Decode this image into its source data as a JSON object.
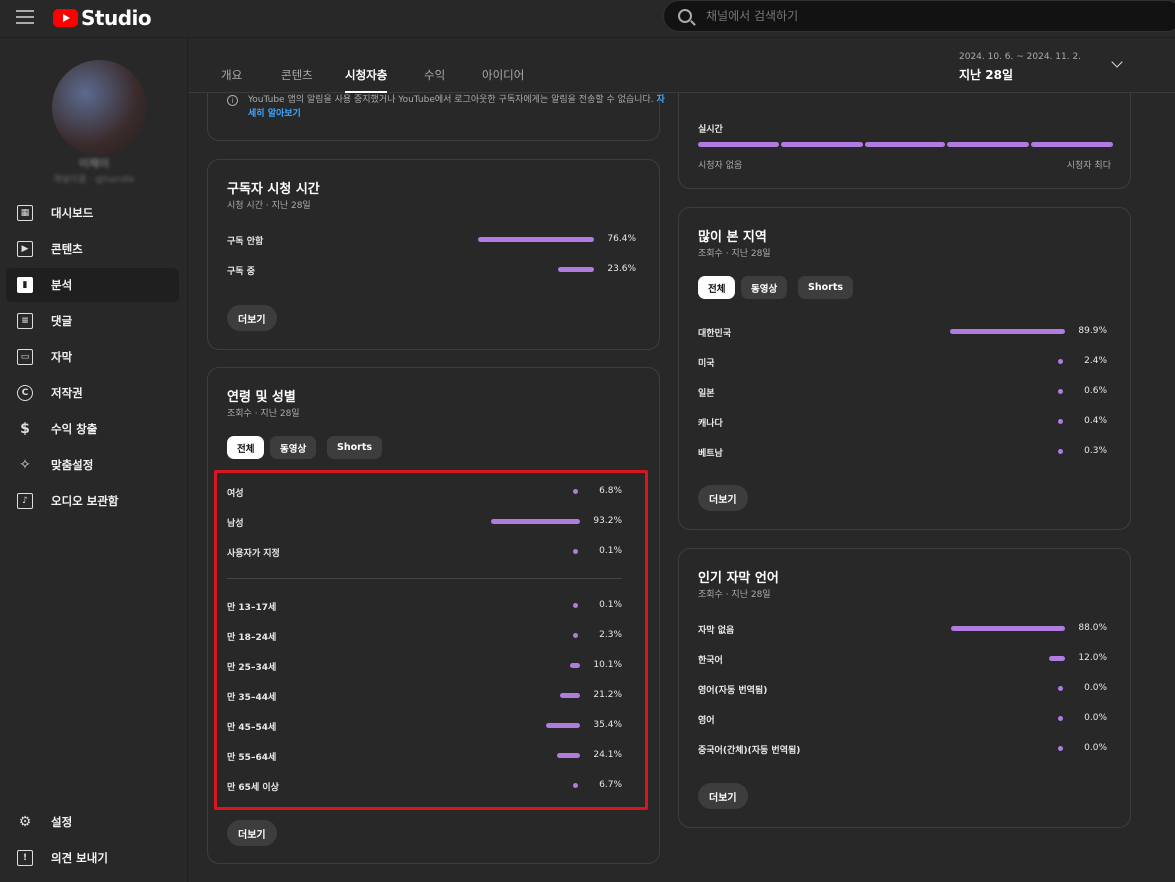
{
  "header": {
    "logo_text": "Studio",
    "search_placeholder": "채널에서 검색하기"
  },
  "sidebar": {
    "channel_name": "이채이",
    "channel_handle": "채널이름 · @handle",
    "items": [
      {
        "label": "대시보드",
        "icon": "dashboard-icon"
      },
      {
        "label": "콘텐츠",
        "icon": "content-icon"
      },
      {
        "label": "분석",
        "icon": "analytics-icon"
      },
      {
        "label": "댓글",
        "icon": "comments-icon"
      },
      {
        "label": "자막",
        "icon": "subtitles-icon"
      },
      {
        "label": "저작권",
        "icon": "copyright-icon"
      },
      {
        "label": "수익 창출",
        "icon": "dollar-icon"
      },
      {
        "label": "맞춤설정",
        "icon": "customization-icon"
      },
      {
        "label": "오디오 보관함",
        "icon": "audio-library-icon"
      }
    ],
    "bottom_items": [
      {
        "label": "설정",
        "icon": "gear-icon"
      },
      {
        "label": "의견 보내기",
        "icon": "feedback-icon"
      }
    ]
  },
  "tabs": [
    {
      "label": "개요"
    },
    {
      "label": "콘텐츠"
    },
    {
      "label": "시청자층"
    },
    {
      "label": "수익"
    },
    {
      "label": "아이디어"
    }
  ],
  "date": {
    "range": "2024. 10. 6. ~ 2024. 11. 2.",
    "label": "지난 28일"
  },
  "notice_card": {
    "text": "YouTube 앱의 알림을 사용 중지했거나 YouTube에서 로그아웃한 구독자에게는 알림을 전송할 수 없습니다.",
    "link": "자세히 알아보기"
  },
  "subscriber_watch": {
    "title": "구독자 시청 시간",
    "subtitle": "시청 시간 · 지난 28일",
    "rows": [
      {
        "label": "구독 안함",
        "pct": "76.4%",
        "value": 76.4
      },
      {
        "label": "구독 중",
        "pct": "23.6%",
        "value": 23.6
      }
    ],
    "more": "더보기"
  },
  "age_gender": {
    "title": "연령 및 성별",
    "subtitle": "조회수 · 지난 28일",
    "chips": [
      "전체",
      "동영상",
      "Shorts"
    ],
    "gender": [
      {
        "label": "여성",
        "pct": "6.8%",
        "value": 6.8
      },
      {
        "label": "남성",
        "pct": "93.2%",
        "value": 93.2
      },
      {
        "label": "사용자가 지정",
        "pct": "0.1%",
        "value": 0.1
      }
    ],
    "age": [
      {
        "label": "만 13–17세",
        "pct": "0.1%",
        "value": 0.1
      },
      {
        "label": "만 18–24세",
        "pct": "2.3%",
        "value": 2.3
      },
      {
        "label": "만 25–34세",
        "pct": "10.1%",
        "value": 10.1
      },
      {
        "label": "만 35–44세",
        "pct": "21.2%",
        "value": 21.2
      },
      {
        "label": "만 45–54세",
        "pct": "35.4%",
        "value": 35.4
      },
      {
        "label": "만 55–64세",
        "pct": "24.1%",
        "value": 24.1
      },
      {
        "label": "만 65세 이상",
        "pct": "6.7%",
        "value": 6.7
      }
    ],
    "more": "더보기"
  },
  "realtime": {
    "label": "실시간",
    "left": "시청자 없음",
    "right": "시청자 최다"
  },
  "top_regions": {
    "title": "많이 본 지역",
    "subtitle": "조회수 · 지난 28일",
    "chips": [
      "전체",
      "동영상",
      "Shorts"
    ],
    "rows": [
      {
        "label": "대한민국",
        "pct": "89.9%",
        "value": 89.9
      },
      {
        "label": "미국",
        "pct": "2.4%",
        "value": 2.4
      },
      {
        "label": "일본",
        "pct": "0.6%",
        "value": 0.6
      },
      {
        "label": "캐나다",
        "pct": "0.4%",
        "value": 0.4
      },
      {
        "label": "베트남",
        "pct": "0.3%",
        "value": 0.3
      }
    ],
    "more": "더보기"
  },
  "subtitle_langs": {
    "title": "인기 자막 언어",
    "subtitle": "조회수 · 지난 28일",
    "rows": [
      {
        "label": "자막 없음",
        "pct": "88.0%",
        "value": 88.0
      },
      {
        "label": "한국어",
        "pct": "12.0%",
        "value": 12.0
      },
      {
        "label": "영어(자동 번역됨)",
        "pct": "0.0%",
        "value": 0.0
      },
      {
        "label": "영어",
        "pct": "0.0%",
        "value": 0.0
      },
      {
        "label": "중국어(간체)(자동 번역됨)",
        "pct": "0.0%",
        "value": 0.0
      }
    ],
    "more": "더보기"
  },
  "colors": {
    "accent_bar": "#b07ce0",
    "highlight": "#d9161f",
    "link": "#3ea6ff"
  }
}
